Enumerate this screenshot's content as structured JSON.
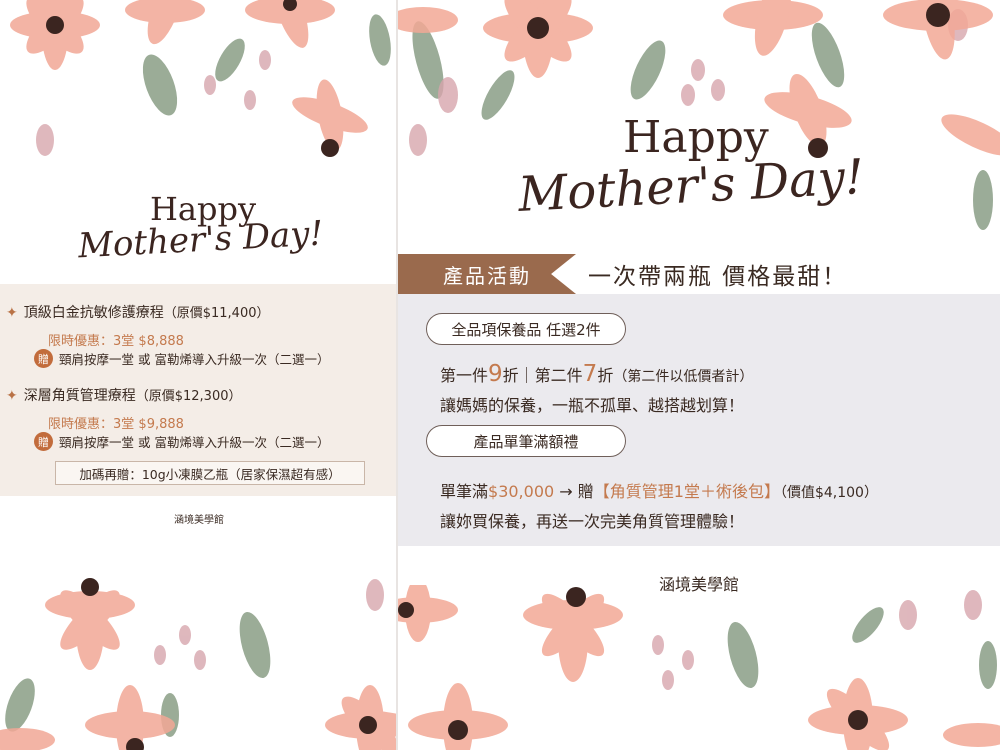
{
  "left": {
    "heading_happy": "Happy",
    "heading_script": "Mother's Day!",
    "items": [
      {
        "title": "頂級白金抗敏修護療程",
        "original_price": "（原價$11,400）",
        "offer_label": "限時優惠：3堂",
        "offer_price": "$8,888",
        "gift_badge": "贈",
        "gift_text": "頸肩按摩一堂 或 富勒烯導入升級一次（二選一）"
      },
      {
        "title": "深層角質管理療程",
        "original_price": "（原價$12,300）",
        "offer_label": "限時優惠：3堂",
        "offer_price": "$9,888",
        "gift_badge": "贈",
        "gift_text": "頸肩按摩一堂 或 富勒烯導入升級一次（二選一）"
      }
    ],
    "bonus": "加碼再贈：10g小凍膜乙瓶（居家保濕超有感）",
    "brand": "涵境美學館"
  },
  "right": {
    "heading_happy": "Happy",
    "heading_script": "Mother's Day!",
    "banner": "產品活動",
    "headline": "一次帶兩瓶 價格最甜！",
    "pill1": "全品項保養品 任選2件",
    "line1": {
      "part_a": "第一件",
      "num_a": "9",
      "part_b": "折｜第二件",
      "num_b": "7",
      "part_c": "折",
      "note": "（第二件以低價者計）"
    },
    "line2": "讓媽媽的保養，一瓶不孤單、越搭越划算！",
    "pill2": "產品單筆滿額禮",
    "line3": {
      "part_a": "單筆滿",
      "amount": "$30,000",
      "arrow": " → 贈",
      "gift": "【角質管理1堂＋術後包】",
      "note": "（價值$4,100）"
    },
    "line4": "讓妳買保養，再送一次完美角質管理體驗！",
    "brand": "涵境美學館"
  },
  "colors": {
    "accent": "#c47a4e",
    "banner": "#9a6a4d",
    "petal": "#f2a896",
    "leaf": "#8a9e86",
    "left_box": "#f4ede7",
    "right_box": "#ebeaee"
  }
}
